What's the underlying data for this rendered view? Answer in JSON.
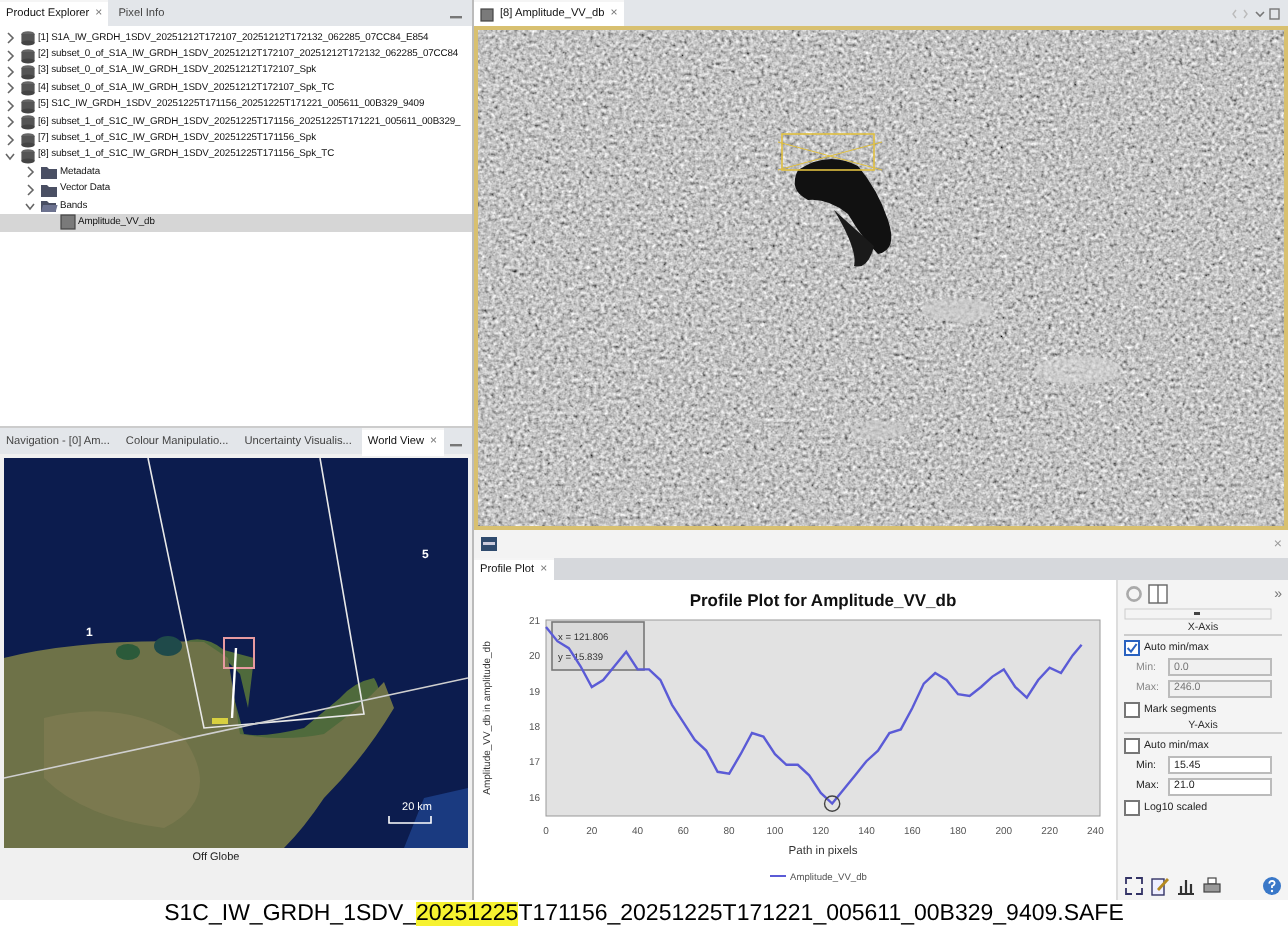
{
  "product_explorer": {
    "tabs": [
      {
        "label": "Product Explorer",
        "selected": true
      },
      {
        "label": "Pixel Info",
        "selected": false
      }
    ],
    "close_glyph": "×",
    "products": [
      {
        "label": "[1] S1A_IW_GRDH_1SDV_20251212T172107_20251212T172132_062285_07CC84_E854",
        "expanded": false,
        "selected": false
      },
      {
        "label": "[2] subset_0_of_S1A_IW_GRDH_1SDV_20251212T172107_20251212T172132_062285_07CC84",
        "expanded": false,
        "selected": false
      },
      {
        "label": "[3] subset_0_of_S1A_IW_GRDH_1SDV_20251212T172107_Spk",
        "expanded": false,
        "selected": false
      },
      {
        "label": "[4] subset_0_of_S1A_IW_GRDH_1SDV_20251212T172107_Spk_TC",
        "expanded": false,
        "selected": false
      },
      {
        "label": "[5] S1C_IW_GRDH_1SDV_20251225T171156_20251225T171221_005611_00B329_9409",
        "expanded": false,
        "selected": false
      },
      {
        "label": "[6] subset_1_of_S1C_IW_GRDH_1SDV_20251225T171156_20251225T171221_005611_00B329_",
        "expanded": false,
        "selected": false
      },
      {
        "label": "[7] subset_1_of_S1C_IW_GRDH_1SDV_20251225T171156_Spk",
        "expanded": false,
        "selected": false
      },
      {
        "label": "[8] subset_1_of_S1C_IW_GRDH_1SDV_20251225T171156_Spk_TC",
        "expanded": true,
        "selected": false,
        "children": [
          {
            "label": "Metadata",
            "expanded": false,
            "selected": false
          },
          {
            "label": "Vector Data",
            "expanded": false,
            "selected": false
          },
          {
            "label": "Bands",
            "expanded": true,
            "selected": false,
            "children": [
              {
                "label": "Amplitude_VV_db",
                "kind": "band",
                "selected": true
              }
            ]
          }
        ]
      }
    ]
  },
  "tool_panel": {
    "tabs": [
      {
        "label": "Navigation - [0] Am...",
        "selected": false
      },
      {
        "label": "Colour Manipulatio...",
        "selected": false
      },
      {
        "label": "Uncertainty Visualis...",
        "selected": false
      },
      {
        "label": "World View",
        "selected": true
      }
    ],
    "close_glyph": "×",
    "map_labels": [
      "5",
      "1"
    ],
    "scale": "20 km",
    "status": "Off Globe"
  },
  "image_view": {
    "tab": {
      "label": "[8] Amplitude_VV_db",
      "selected": true
    },
    "close_glyph": "×"
  },
  "profile_plot": {
    "tab": {
      "label": "Profile Plot",
      "selected": true
    },
    "close_glyph": "×",
    "panel_close": "×",
    "readout": [
      "x = 121.806",
      "y = 15.839"
    ],
    "chart_data": {
      "type": "line",
      "title": "Profile Plot for Amplitude_VV_db",
      "xlabel": "Path in pixels",
      "ylabel": "Amplitude_VV_db in amplitude_db",
      "x": [
        0,
        5,
        10,
        15,
        20,
        25,
        30,
        35,
        40,
        45,
        50,
        55,
        60,
        65,
        70,
        75,
        80,
        85,
        90,
        95,
        100,
        105,
        110,
        115,
        120,
        125,
        130,
        135,
        140,
        145,
        150,
        155,
        160,
        165,
        170,
        175,
        180,
        185,
        190,
        195,
        200,
        205,
        210,
        215,
        220,
        225,
        230,
        234
      ],
      "series": [
        {
          "name": "Amplitude_VV_db",
          "color": "#5b5bd6",
          "values": [
            20.8,
            20.4,
            20.2,
            19.7,
            19.1,
            19.3,
            19.7,
            20.1,
            19.6,
            19.6,
            19.3,
            18.6,
            18.1,
            17.6,
            17.3,
            16.7,
            16.65,
            17.2,
            17.8,
            17.7,
            17.2,
            16.9,
            16.9,
            16.6,
            16.1,
            15.8,
            16.2,
            16.6,
            17.0,
            17.3,
            17.8,
            17.9,
            18.5,
            19.2,
            19.5,
            19.3,
            18.9,
            18.85,
            19.1,
            19.4,
            19.6,
            19.1,
            18.8,
            19.3,
            19.65,
            19.5,
            20.0,
            20.3
          ]
        }
      ],
      "xlim": [
        0,
        242
      ],
      "ylim": [
        15.45,
        21.0
      ],
      "xticks": [
        0,
        20,
        40,
        60,
        80,
        100,
        120,
        140,
        160,
        180,
        200,
        220,
        240
      ],
      "yticks": [
        16,
        17,
        18,
        19,
        20,
        21
      ]
    },
    "options": [
      {
        "kind": "heading",
        "label": "X-Axis"
      },
      {
        "kind": "checkbox",
        "label": "Auto min/max",
        "checked": true
      },
      {
        "kind": "field",
        "label": "Min:",
        "value": "0.0",
        "disabled": true
      },
      {
        "kind": "field",
        "label": "Max:",
        "value": "246.0",
        "disabled": true
      },
      {
        "kind": "checkbox",
        "label": "Mark segments",
        "checked": false
      },
      {
        "kind": "heading",
        "label": "Y-Axis"
      },
      {
        "kind": "checkbox",
        "label": "Auto min/max",
        "checked": false
      },
      {
        "kind": "field",
        "label": "Min:",
        "value": "15.45",
        "disabled": false
      },
      {
        "kind": "field",
        "label": "Max:",
        "value": "21.0",
        "disabled": false
      },
      {
        "kind": "checkbox",
        "label": "Log10 scaled",
        "checked": false
      }
    ],
    "expand_glyph": "»"
  },
  "caption": {
    "before": "S1C_IW_GRDH_1SDV_",
    "highlight": "20251225",
    "after": "T171156_20251225T171221_005611_00B329_9409.SAFE"
  }
}
